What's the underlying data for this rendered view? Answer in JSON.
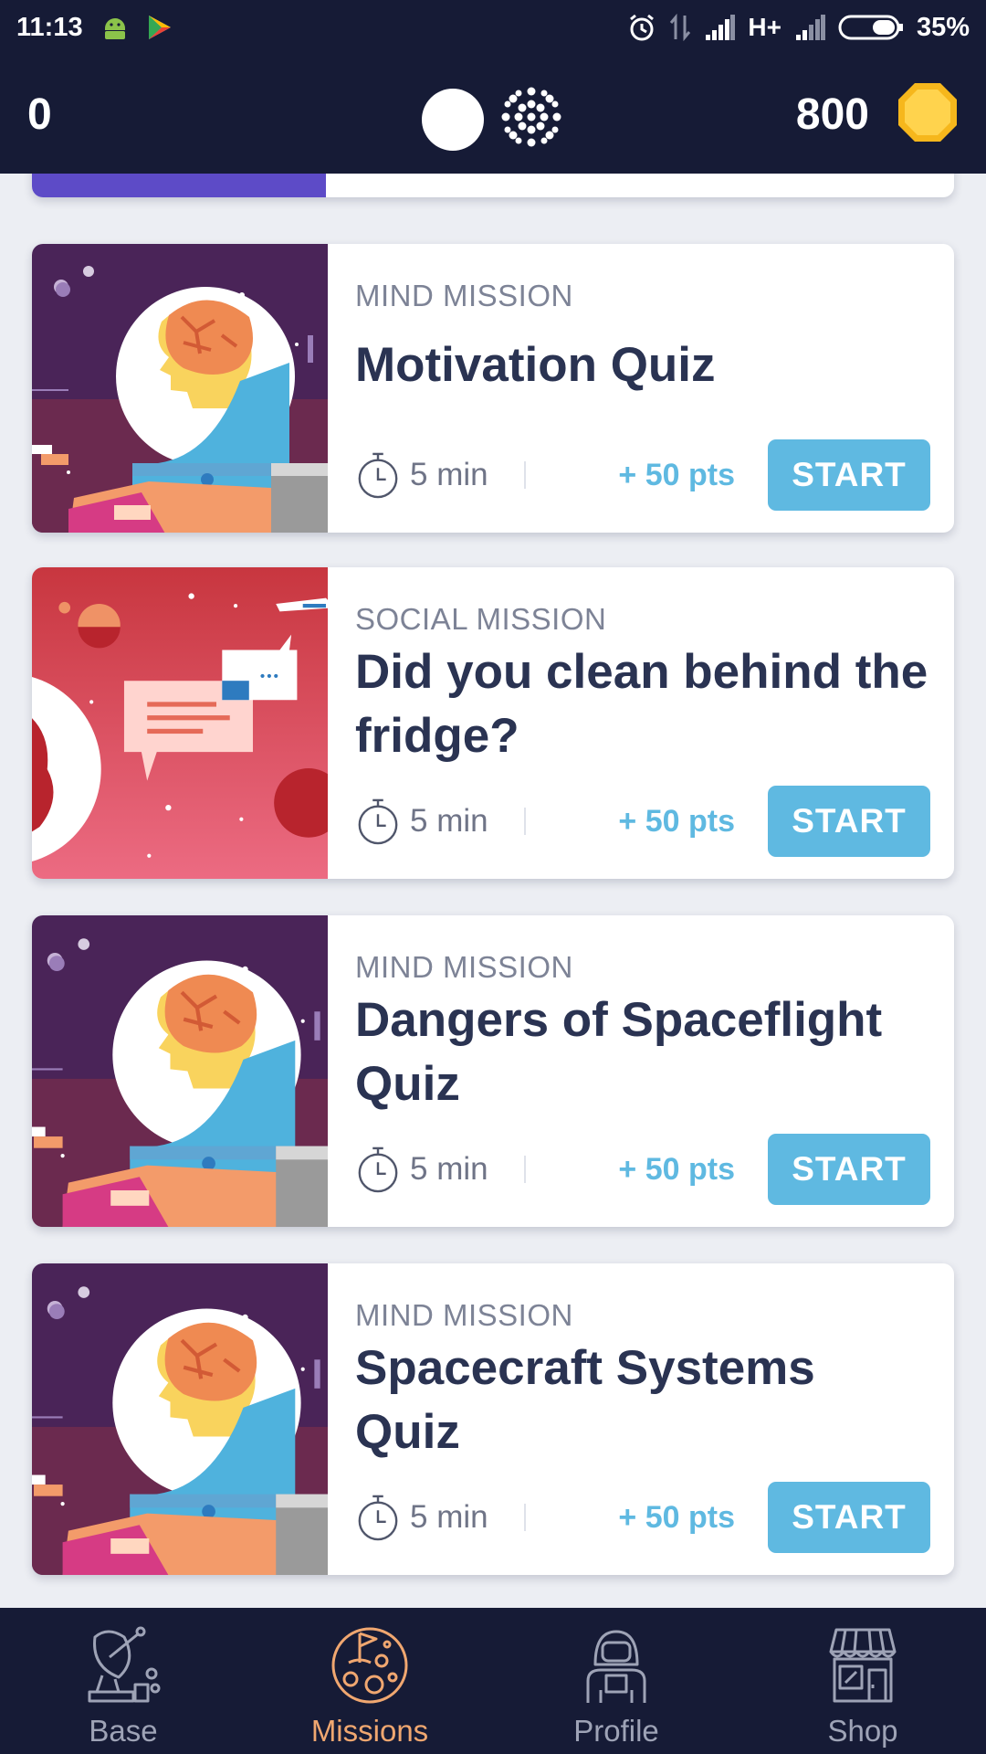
{
  "status_bar": {
    "time": "11:13",
    "network": "H+",
    "battery": "35%",
    "icons": [
      "android-icon",
      "play-store-icon",
      "alarm-icon",
      "data-transfer-icon",
      "signal-icon",
      "signal-weak-icon",
      "battery-icon"
    ]
  },
  "header": {
    "score": "0",
    "coins": "800",
    "icons": [
      "white-dot-icon",
      "dotted-circle-icon",
      "coin-icon"
    ]
  },
  "missions": [
    {
      "category": "MIND MISSION",
      "title": "Motivation Quiz",
      "duration": "5 min",
      "points": "+ 50 pts",
      "button": "START",
      "image": "astronaut-brain-illustration"
    },
    {
      "category": "SOCIAL MISSION",
      "title": "Did you clean behind the fridge?",
      "duration": "5 min",
      "points": "+ 50 pts",
      "button": "START",
      "image": "chat-bubbles-illustration"
    },
    {
      "category": "MIND MISSION",
      "title": "Dangers of Spaceflight Quiz",
      "duration": "5 min",
      "points": "+ 50 pts",
      "button": "START",
      "image": "astronaut-brain-illustration"
    },
    {
      "category": "MIND MISSION",
      "title": "Spacecraft Systems Quiz",
      "duration": "5 min",
      "points": "+ 50 pts",
      "button": "START",
      "image": "astronaut-brain-illustration"
    }
  ],
  "bottom_nav": {
    "items": [
      {
        "label": "Base",
        "icon": "satellite-dish-icon",
        "active": false
      },
      {
        "label": "Missions",
        "icon": "planet-flag-icon",
        "active": true
      },
      {
        "label": "Profile",
        "icon": "astronaut-icon",
        "active": false
      },
      {
        "label": "Shop",
        "icon": "storefront-icon",
        "active": false
      }
    ]
  },
  "colors": {
    "header_bg": "#161b36",
    "accent_blue": "#5fb9e1",
    "active_orange": "#f0a770",
    "title_text": "#2a3352"
  }
}
